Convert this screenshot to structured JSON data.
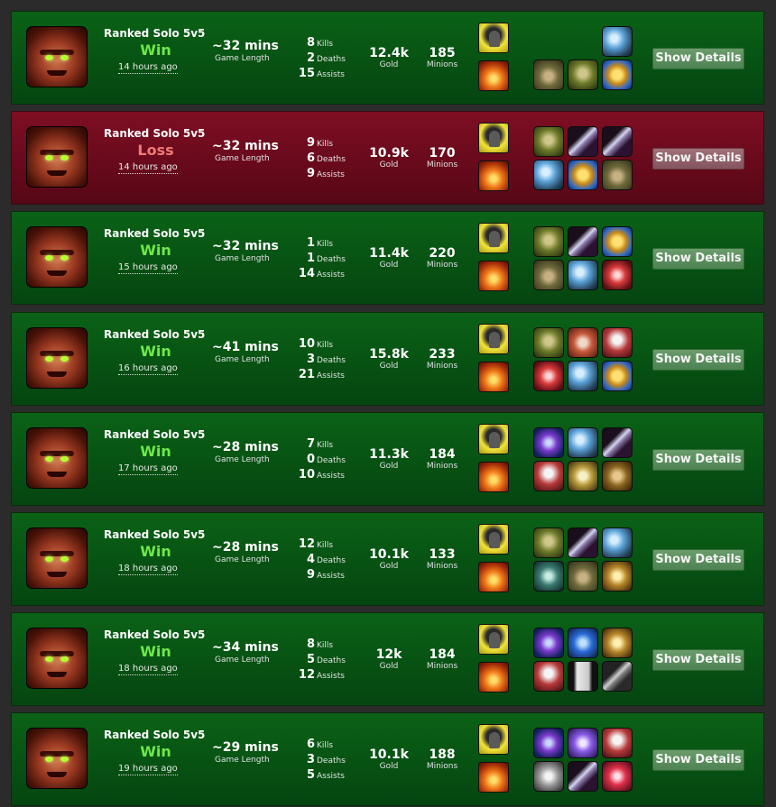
{
  "matches": [
    {
      "result": "Win",
      "queue": "Ranked Solo 5v5",
      "ago": "14 hours ago",
      "length": "~32 mins",
      "length_label": "Game Length",
      "kills": "8",
      "deaths": "2",
      "assists": "15",
      "gold": "12.4k",
      "minions": "185",
      "spells": [
        "flash-spell",
        "ignite-spell"
      ],
      "items": [
        "",
        "",
        "hammer-item",
        "boots-item",
        "hat-item",
        "shield-item"
      ]
    },
    {
      "result": "Loss",
      "queue": "Ranked Solo 5v5",
      "ago": "14 hours ago",
      "length": "~32 mins",
      "length_label": "Game Length",
      "kills": "9",
      "deaths": "6",
      "assists": "9",
      "gold": "10.9k",
      "minions": "170",
      "spells": [
        "flash-spell",
        "ignite-spell"
      ],
      "items": [
        "hat-item",
        "sword-item",
        "sword-item",
        "hammer-item",
        "shield-item",
        "boots-item"
      ]
    },
    {
      "result": "Win",
      "queue": "Ranked Solo 5v5",
      "ago": "15 hours ago",
      "length": "~32 mins",
      "length_label": "Game Length",
      "kills": "1",
      "deaths": "1",
      "assists": "14",
      "gold": "11.4k",
      "minions": "220",
      "spells": [
        "flash-spell",
        "ignite-spell"
      ],
      "items": [
        "hat-item",
        "sword-item",
        "shield-item",
        "boots-item",
        "hammer-item",
        "crystal-item"
      ]
    },
    {
      "result": "Win",
      "queue": "Ranked Solo 5v5",
      "ago": "16 hours ago",
      "length": "~41 mins",
      "length_label": "Game Length",
      "kills": "10",
      "deaths": "3",
      "assists": "21",
      "gold": "15.8k",
      "minions": "233",
      "spells": [
        "flash-spell",
        "ignite-spell"
      ],
      "items": [
        "hat-item",
        "cleaver-item",
        "axe-item",
        "crystal-item",
        "hammer-item",
        "shield-item"
      ]
    },
    {
      "result": "Win",
      "queue": "Ranked Solo 5v5",
      "ago": "17 hours ago",
      "length": "~28 mins",
      "length_label": "Game Length",
      "kills": "7",
      "deaths": "0",
      "assists": "10",
      "gold": "11.3k",
      "minions": "184",
      "spells": [
        "flash-spell",
        "ignite-spell"
      ],
      "items": [
        "potion-item",
        "hammer-item",
        "sword-item",
        "axe-item",
        "armor-item",
        "cloak-item"
      ]
    },
    {
      "result": "Win",
      "queue": "Ranked Solo 5v5",
      "ago": "18 hours ago",
      "length": "~28 mins",
      "length_label": "Game Length",
      "kills": "12",
      "deaths": "4",
      "assists": "9",
      "gold": "10.1k",
      "minions": "133",
      "spells": [
        "flash-spell",
        "ignite-spell"
      ],
      "items": [
        "hat-item",
        "sword-item",
        "hammer-item",
        "dagger-item",
        "boots-item",
        "gauntlet-item"
      ]
    },
    {
      "result": "Win",
      "queue": "Ranked Solo 5v5",
      "ago": "18 hours ago",
      "length": "~34 mins",
      "length_label": "Game Length",
      "kills": "8",
      "deaths": "5",
      "assists": "12",
      "gold": "12k",
      "minions": "184",
      "spells": [
        "flash-spell",
        "ignite-spell"
      ],
      "items": [
        "potion-item",
        "bow-item",
        "gauntlet-item",
        "axe-item",
        "card-item",
        "blade-item"
      ]
    },
    {
      "result": "Win",
      "queue": "Ranked Solo 5v5",
      "ago": "19 hours ago",
      "length": "~29 mins",
      "length_label": "Game Length",
      "kills": "6",
      "deaths": "3",
      "assists": "5",
      "gold": "10.1k",
      "minions": "188",
      "spells": [
        "flash-spell",
        "ignite-spell"
      ],
      "items": [
        "potion-item",
        "orb-item",
        "axe-item",
        "chest-item",
        "sword-item",
        "gem-item"
      ]
    }
  ],
  "labels": {
    "kills": "Kills",
    "deaths": "Deaths",
    "assists": "Assists",
    "gold": "Gold",
    "minions": "Minions",
    "details": "Show Details"
  },
  "colors": {
    "win_bg": "#075213",
    "loss_bg": "#690a1c",
    "win_text": "#6ee84a",
    "loss_text": "#f07a74",
    "page_bg": "#2b2b2b"
  }
}
